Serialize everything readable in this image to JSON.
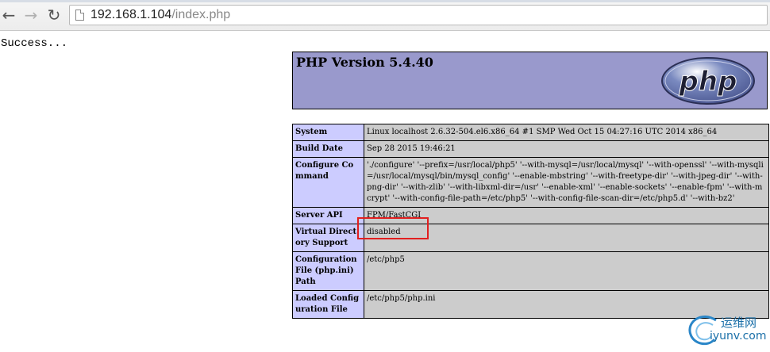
{
  "browser": {
    "back_glyph": "←",
    "forward_glyph": "→",
    "reload_glyph": "↻",
    "url_host": "192.168.1.104",
    "url_path": "/index.php"
  },
  "page": {
    "status_text": "Success...",
    "php_title": "PHP Version 5.4.40",
    "logo_text": "php",
    "info_rows": [
      {
        "key": "System",
        "value": "Linux localhost 2.6.32-504.el6.x86_64 #1 SMP Wed Oct 15 04:27:16 UTC 2014 x86_64"
      },
      {
        "key": "Build Date",
        "value": "Sep 28 2015 19:46:21"
      },
      {
        "key": "Configure Command",
        "value": "'./configure' '--prefix=/usr/local/php5' '--with-mysql=/usr/local/mysql' '--with-openssl' '--with-mysqli=/usr/local/mysql/bin/mysql_config' '--enable-mbstring' '--with-freetype-dir' '--with-jpeg-dir' '--with-png-dir' '--with-zlib' '--with-libxml-dir=/usr' '--enable-xml' '--enable-sockets' '--enable-fpm' '--with-mcrypt' '--with-config-file-path=/etc/php5' '--with-config-file-scan-dir=/etc/php5.d' '--with-bz2'"
      },
      {
        "key": "Server API",
        "value": "FPM/FastCGI"
      },
      {
        "key": "Virtual Directory Support",
        "value": "disabled"
      },
      {
        "key": "Configuration File (php.ini) Path",
        "value": "/etc/php5"
      },
      {
        "key": "Loaded Configuration File",
        "value": "/etc/php5/php.ini"
      }
    ]
  },
  "watermark": {
    "cn_text": "运维网",
    "url_text": "iyunv.com"
  },
  "colors": {
    "header_bg": "#9999cc",
    "key_bg": "#ccccff",
    "value_bg": "#cccccc",
    "highlight": "#e21f1f"
  }
}
